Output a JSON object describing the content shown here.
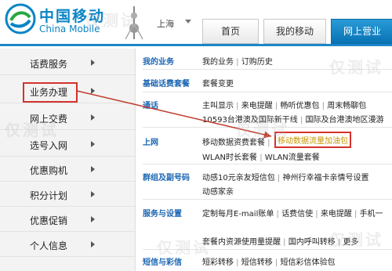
{
  "brand": {
    "name_cn": "中国移动",
    "name_en": "China Mobile",
    "city": "上海"
  },
  "topnav": [
    {
      "label": "首页",
      "active": false
    },
    {
      "label": "我的移动",
      "active": false
    },
    {
      "label": "网上营业",
      "active": true
    }
  ],
  "sidebar": {
    "items": [
      {
        "label": "话费服务"
      },
      {
        "label": "业务办理",
        "highlighted": true
      },
      {
        "label": "网上交费"
      },
      {
        "label": "选号入网"
      },
      {
        "label": "优惠购机"
      },
      {
        "label": "积分计划"
      },
      {
        "label": "优惠促销"
      },
      {
        "label": "个人信息"
      }
    ]
  },
  "main": {
    "rows": [
      {
        "category": "我的业务",
        "links": [
          "我的业务",
          "订购历史"
        ]
      },
      {
        "category": "基础话费套餐",
        "links": [
          "套餐变更"
        ]
      },
      {
        "category": "通话",
        "links": [
          "主叫显示",
          "来电提醒",
          "畅听优惠包",
          "周末畅聊包"
        ],
        "links2": [
          "10593台港澳及国际新干线",
          "国际及台港澳地区漫游"
        ]
      },
      {
        "category": "上网",
        "links": [
          "移动数据资费套餐"
        ],
        "highlight": "移动数据流量加油包",
        "links2": [
          "WLAN时长套餐",
          "WLAN流量套餐"
        ]
      },
      {
        "category": "群组及副号码",
        "links": [
          "动感10元亲友短信包",
          "神州行幸福卡亲情号设置"
        ],
        "links2": [
          "动感家亲"
        ]
      },
      {
        "category": "服务与设置",
        "links": [
          "定制每月E-mail账单",
          "话费信使",
          "来电提醒",
          "手机一"
        ],
        "links2": [
          "套餐内资源使用量提醒",
          "国内呼叫转移",
          "更多"
        ]
      },
      {
        "category": "短信与彩信",
        "links": [
          "短彩转移",
          "短信转移",
          "短信彩信体验包"
        ]
      }
    ]
  },
  "watermark": "仅测试",
  "colors": {
    "brand_blue": "#0a84c6",
    "nav_active": "#0872b3",
    "highlight_border": "#d4322c",
    "link_blue": "#1a66b3"
  }
}
